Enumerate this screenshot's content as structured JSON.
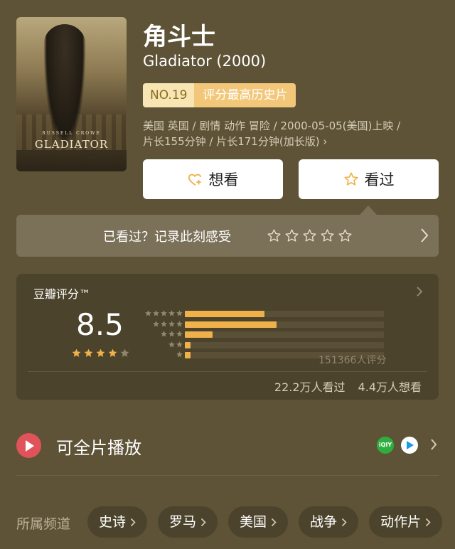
{
  "movie": {
    "title_cn": "角斗士",
    "title_en": "Gladiator (2000)",
    "poster": {
      "actor": "RUSSELL CROWE",
      "title": "GLADIATOR"
    },
    "rank_no": "NO.19",
    "rank_label": "评分最高历史片",
    "meta_line1": "美国 英国 / 剧情 动作 冒险 / 2000-05-05(美国)上映 /",
    "meta_line2": "片长155分钟 / 片长171分钟(加长版) ›"
  },
  "actions": {
    "want_label": "想看",
    "seen_label": "看过"
  },
  "record": {
    "label": "已看过？记录此刻感受",
    "star_count": 5
  },
  "rating": {
    "title": "豆瓣评分™",
    "score": "8.5",
    "stars_filled": 4,
    "stars_total": 5,
    "distribution": [
      {
        "stars": 5,
        "fraction": 0.4
      },
      {
        "stars": 4,
        "fraction": 0.46
      },
      {
        "stars": 3,
        "fraction": 0.14
      },
      {
        "stars": 2,
        "fraction": 0.03
      },
      {
        "stars": 1,
        "fraction": 0.03
      }
    ],
    "raters": "151366人评分",
    "watched": "22.2万人看过",
    "wish": "4.4万人想看"
  },
  "play": {
    "label": "可全片播放",
    "source1_icon": "iqiyi-icon",
    "source1_text": "iQIY",
    "source2_icon": "tencent-video-icon"
  },
  "channels": {
    "label": "所属频道",
    "tags": [
      "史诗",
      "罗马",
      "美国",
      "战争",
      "动作片"
    ]
  },
  "colors": {
    "background": "#5e5337",
    "accent": "#f0b14a",
    "rank_bg": "#f7e6b3",
    "rank_label_bg": "#f3c779"
  }
}
